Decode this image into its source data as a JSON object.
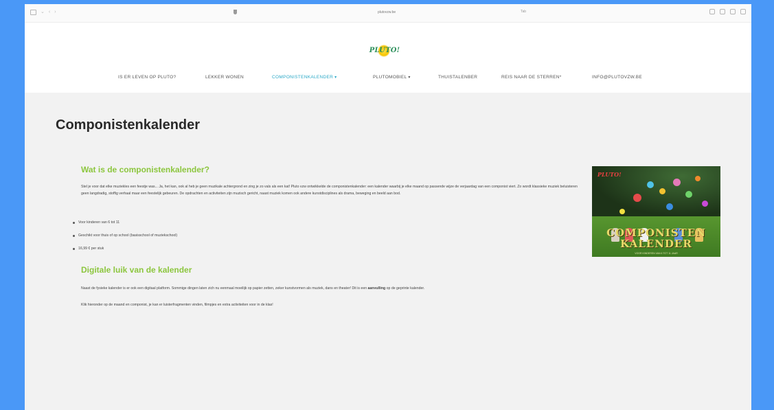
{
  "browser": {
    "url": "plutovzw.be",
    "url2": "Tab"
  },
  "site": {
    "logo_text": "PLUTO!"
  },
  "nav": {
    "items": [
      {
        "label": "IS ER LEVEN OP PLUTO?",
        "has_dropdown": false,
        "active": false
      },
      {
        "label": "LEKKER WONEN",
        "has_dropdown": false,
        "active": false
      },
      {
        "label": "COMPONISTENKALENDER",
        "has_dropdown": true,
        "active": true
      },
      {
        "label": "PLUTOMOBIEL",
        "has_dropdown": true,
        "active": false
      },
      {
        "label": "THUISTALENBER",
        "has_dropdown": false,
        "active": false
      },
      {
        "label": "REIS NAAR DE STERREN*",
        "has_dropdown": false,
        "active": false
      },
      {
        "label": "INFO@PLUTOVZW.BE",
        "has_dropdown": false,
        "active": false
      }
    ]
  },
  "page": {
    "title": "Componistenkalender",
    "section1": {
      "heading": "Wat is de componistenkalender?",
      "paragraph": "Stel je voor dat elke muziekles een feestje was... Ja, het kan, ook al heb je geen muzikale achtergrond en zing je zo vals als een kat! Pluto vzw ontwikkelde de componistenkalender: een kalender waarbij je elke maand op passende wijze de verjaardag van een componist viert. Zo wordt klassieke muziek beluisteren geen langdradig, stoffig verhaal maar een feestelijk gebeuren. De opdrachten en activiteiten zijn muzisch gericht, naast muziek komen ook andere kunstdisciplines als drama, beweging en beeld aan bod.",
      "bullets": [
        "Voor kinderen van 6 tot 11",
        "Geschikt voor thuis of op school (basisschool of muziekschool)",
        "16,99 € per stuk"
      ]
    },
    "section2": {
      "heading": "Digitale luik van de kalender",
      "paragraph_before": "Naast de fysieke kalender is er ook een digitaal platform. Sommige dingen laten zich nu eenmaal moeilijk op papier zetten, zeker kunstvormen als muziek, dans en theater! Dit is een ",
      "paragraph_bold": "aanvulling",
      "paragraph_after": " op de geprinte kalender.",
      "paragraph2": "Klik hieronder op de maand en componist, je kan er luisterfragmenten vinden, filmpjes en extra activiteiten voor in de klas!"
    },
    "image": {
      "logo": "PLUTO!",
      "title_line1": "COMPONISTEN",
      "title_line2": "KALENDER",
      "subtitle": "VOOR KINDEREN VAN 6 TOT 11 JAAR"
    }
  },
  "colors": {
    "background": "#4a98f7",
    "accent_green": "#8cc63e",
    "nav_active": "#2aa8c7"
  }
}
